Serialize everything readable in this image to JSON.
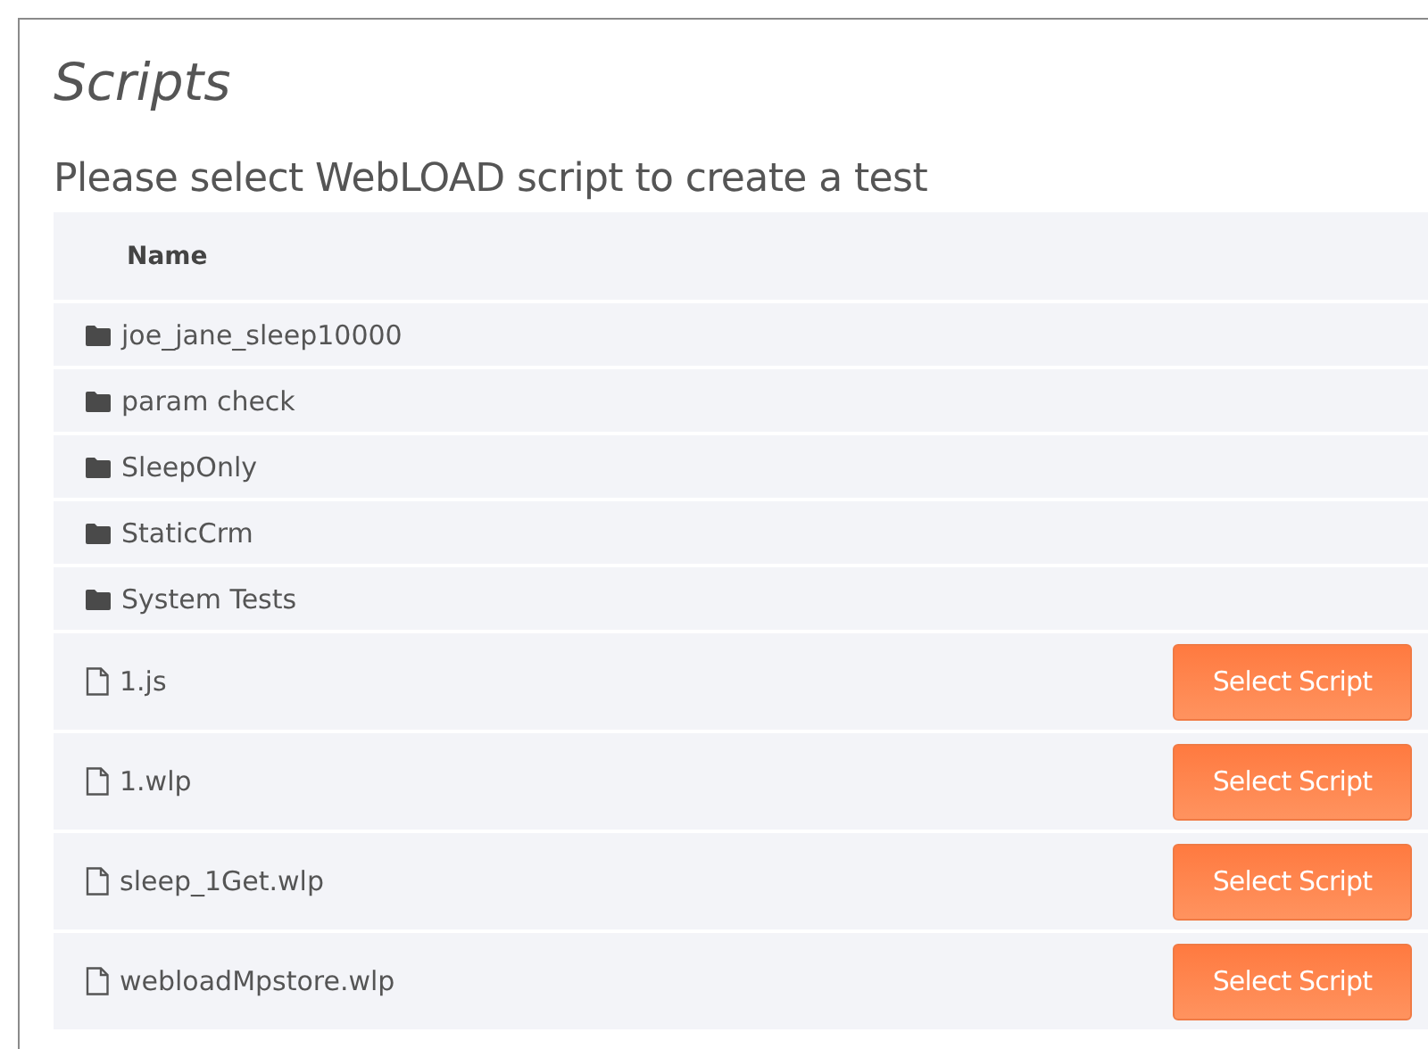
{
  "title": "Scripts",
  "subtitle": "Please select WebLOAD script to create a test",
  "table": {
    "columns": [
      "Name"
    ],
    "rows": [
      {
        "kind": "folder",
        "name": "joe_jane_sleep10000"
      },
      {
        "kind": "folder",
        "name": "param check"
      },
      {
        "kind": "folder",
        "name": "SleepOnly"
      },
      {
        "kind": "folder",
        "name": "StaticCrm"
      },
      {
        "kind": "folder",
        "name": "System Tests"
      },
      {
        "kind": "file",
        "name": "1.js",
        "button": "Select Script"
      },
      {
        "kind": "file",
        "name": "1.wlp",
        "button": "Select Script"
      },
      {
        "kind": "file",
        "name": "sleep_1Get.wlp",
        "button": "Select Script"
      },
      {
        "kind": "file",
        "name": "webloadMpstore.wlp",
        "button": "Select Script"
      }
    ]
  }
}
